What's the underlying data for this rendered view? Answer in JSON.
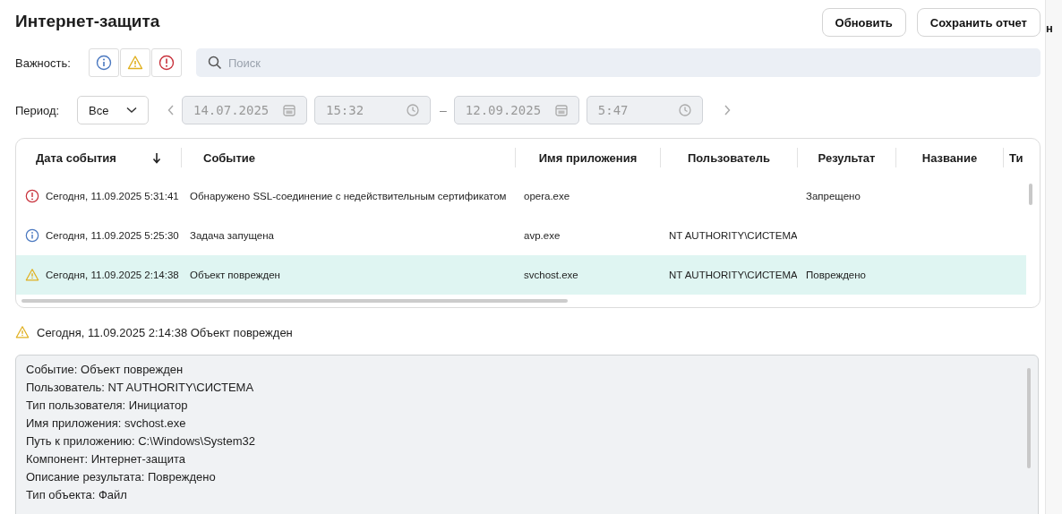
{
  "title": "Интернет-защита",
  "buttons": [
    "Обновить",
    "Сохранить отчет"
  ],
  "side_panel": {
    "text": "н"
  },
  "severity": {
    "label": "Важность:",
    "filters": [
      {
        "kind": "info",
        "selected": false
      },
      {
        "kind": "warning",
        "selected": false
      },
      {
        "kind": "error",
        "selected": false
      }
    ]
  },
  "search": {
    "placeholder": "Поиск"
  },
  "period": {
    "label": "Период:",
    "value": "Все",
    "from_date": "14.07.2025",
    "from_time": "15:32",
    "separator": "–",
    "to_date": "12.09.2025",
    "to_time": "5:47"
  },
  "table": {
    "columns": [
      {
        "label": "Дата события",
        "sorted": true
      },
      {
        "label": "Событие",
        "sorted": false
      },
      {
        "label": "Имя приложения",
        "sorted": false
      },
      {
        "label": "Пользователь",
        "sorted": false
      },
      {
        "label": "Результат",
        "sorted": false
      },
      {
        "label": "Название",
        "sorted": false
      },
      {
        "label": "Ти",
        "sorted": false
      }
    ],
    "rows": [
      {
        "kind": "error",
        "selected": false,
        "cells": [
          "Сегодня, 11.09.2025 5:31:41",
          "Обнаружено SSL-соединение с недействительным сертификатом",
          "opera.exe",
          null,
          "Запрещено",
          null,
          null
        ]
      },
      {
        "kind": "info",
        "selected": false,
        "cells": [
          "Сегодня, 11.09.2025 5:25:30",
          "Задача запущена",
          "avp.exe",
          "NT AUTHORITY\\СИСТЕМА",
          null,
          null,
          null
        ]
      },
      {
        "kind": "warning",
        "selected": true,
        "cells": [
          "Сегодня, 11.09.2025 2:14:38",
          "Объект поврежден",
          "svchost.exe",
          "NT AUTHORITY\\СИСТЕМА",
          "Повреждено",
          null,
          null
        ]
      }
    ]
  },
  "details": {
    "kind": "warning",
    "heading": "Сегодня, 11.09.2025 2:14:38 Объект поврежден",
    "lines": [
      "Событие: Объект поврежден",
      "Пользователь: NT AUTHORITY\\СИСТЕМА",
      "Тип пользователя: Инициатор",
      "Имя приложения: svchost.exe",
      "Путь к приложению: C:\\Windows\\System32",
      "Компонент: Интернет-защита",
      "Описание результата: Повреждено",
      "Тип объекта: Файл"
    ]
  }
}
